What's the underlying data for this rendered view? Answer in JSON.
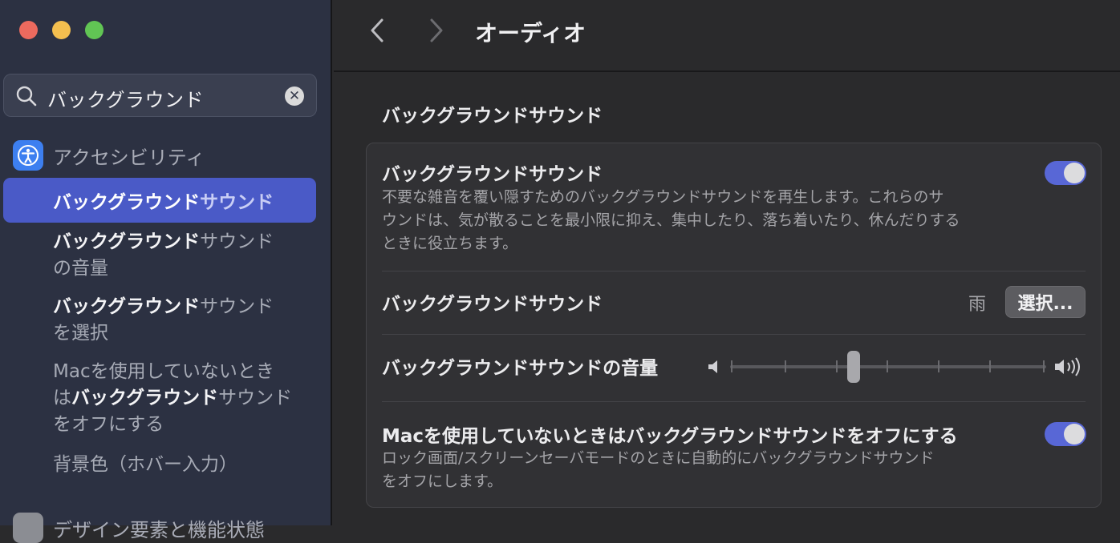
{
  "sidebar": {
    "search": {
      "value": "バックグラウンド"
    },
    "category": "アクセシビリティ",
    "items": [
      {
        "bold": "バックグラウンド",
        "rest": "サウンド"
      },
      {
        "bold": "バックグラウンド",
        "rest": "サウンド",
        "line2": "の音量"
      },
      {
        "bold": "バックグラウンド",
        "rest": "サウンド",
        "line2": "を選択"
      },
      {
        "line1": "Macを使用していないとき",
        "pre": "は",
        "bold": "バックグラウンド",
        "rest": "サウンド",
        "line3": "をオフにする"
      },
      {
        "text": "背景色（ホバー入力）"
      }
    ],
    "bottom_category": "デザイン要素と機能状態"
  },
  "toolbar": {
    "title": "オーディオ"
  },
  "section": {
    "title": "バックグラウンドサウンド"
  },
  "rows": {
    "bg_sound": {
      "title": "バックグラウンドサウンド",
      "desc_line1": "不要な雑音を覆い隠すためのバックグラウンドサウンドを再生します。これらのサ",
      "desc_line2": "ウンドは、気が散ることを最小限に抑え、集中したり、落ち着いたり、休んだりする",
      "desc_line3": "ときに役立ちます。",
      "enabled": true
    },
    "sound_choice": {
      "title": "バックグラウンドサウンド",
      "value": "雨",
      "button": "選択..."
    },
    "volume": {
      "title": "バックグラウンドサウンドの音量",
      "level": 0.39
    },
    "auto_off": {
      "title": "Macを使用していないときはバックグラウンドサウンドをオフにする",
      "desc_line1": "ロック画面/スクリーンセーバモードのときに自動的にバックグラウンドサウンド",
      "desc_line2": "をオフにします。",
      "enabled": true
    }
  },
  "colors": {
    "accent": "#5867d6",
    "sidebar_selected": "#4a5ac7",
    "accessibility_icon": "#3d7ff0"
  }
}
